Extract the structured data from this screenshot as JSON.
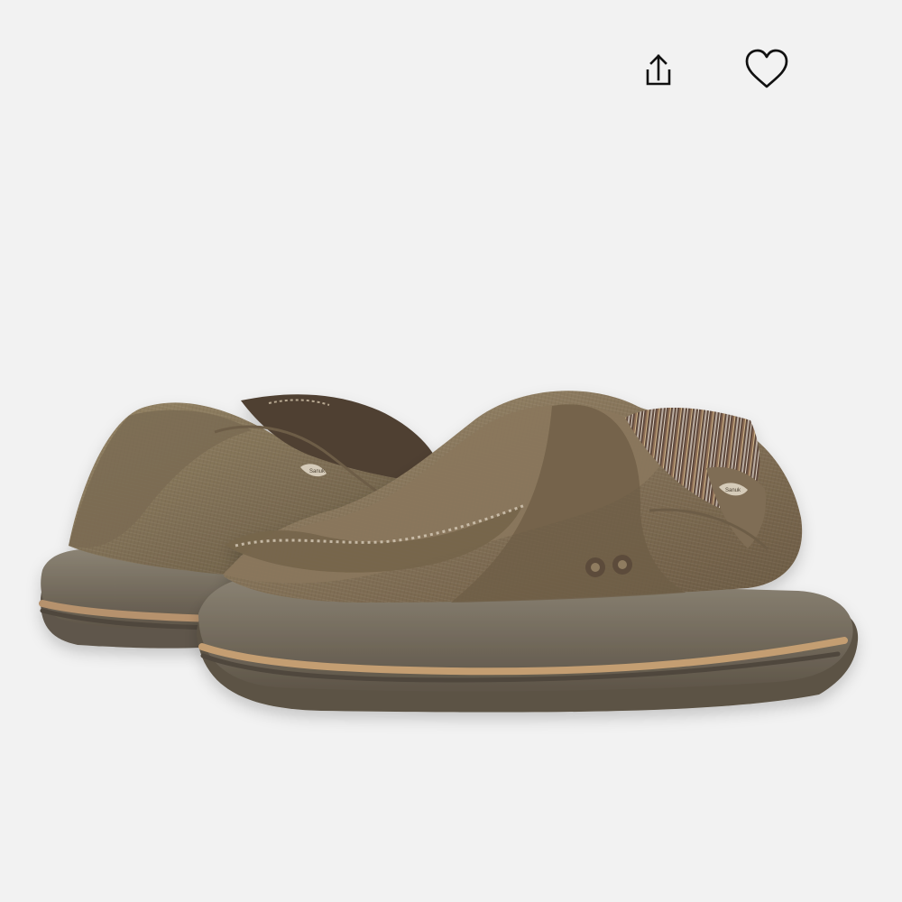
{
  "actions": {
    "share": {
      "icon": "share-icon"
    },
    "favorite": {
      "icon": "heart-icon"
    }
  },
  "product": {
    "image": {
      "brand_mark": "Sanuk"
    },
    "colors": {
      "background": "#f2f2f2",
      "canvas": "#8b7a60",
      "canvas_shadow": "#6a5b45",
      "sole": "#6b6356",
      "sole_stripe": "#c49e72",
      "lining_stripe_dark": "#5b4639",
      "lining_stripe_light": "#b9aca1"
    }
  }
}
